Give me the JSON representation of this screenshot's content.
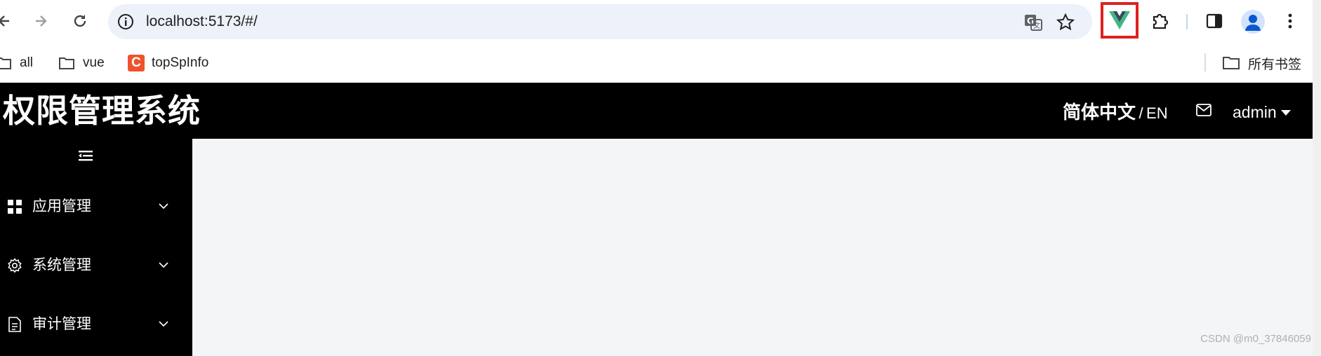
{
  "browser": {
    "url": "localhost:5173/#/",
    "bookmarks": [
      {
        "label": "all",
        "icon": "folder-icon"
      },
      {
        "label": "vue",
        "icon": "folder-icon"
      },
      {
        "label": "topSpInfo",
        "icon": "c-favicon-icon",
        "favicon_text": "C"
      }
    ],
    "all_bookmarks_label": "所有书签",
    "extension_highlight_color": "#e02020",
    "vue_color": "#41b883"
  },
  "app": {
    "title": "权限管理系统",
    "lang_zh": "简体中文",
    "lang_sep": "/",
    "lang_en": "EN",
    "username": "admin",
    "menu": [
      {
        "label": "应用管理",
        "icon": "grid-icon"
      },
      {
        "label": "系统管理",
        "icon": "gear-icon"
      },
      {
        "label": "审计管理",
        "icon": "document-icon"
      }
    ]
  },
  "watermark": "CSDN @m0_37846059"
}
